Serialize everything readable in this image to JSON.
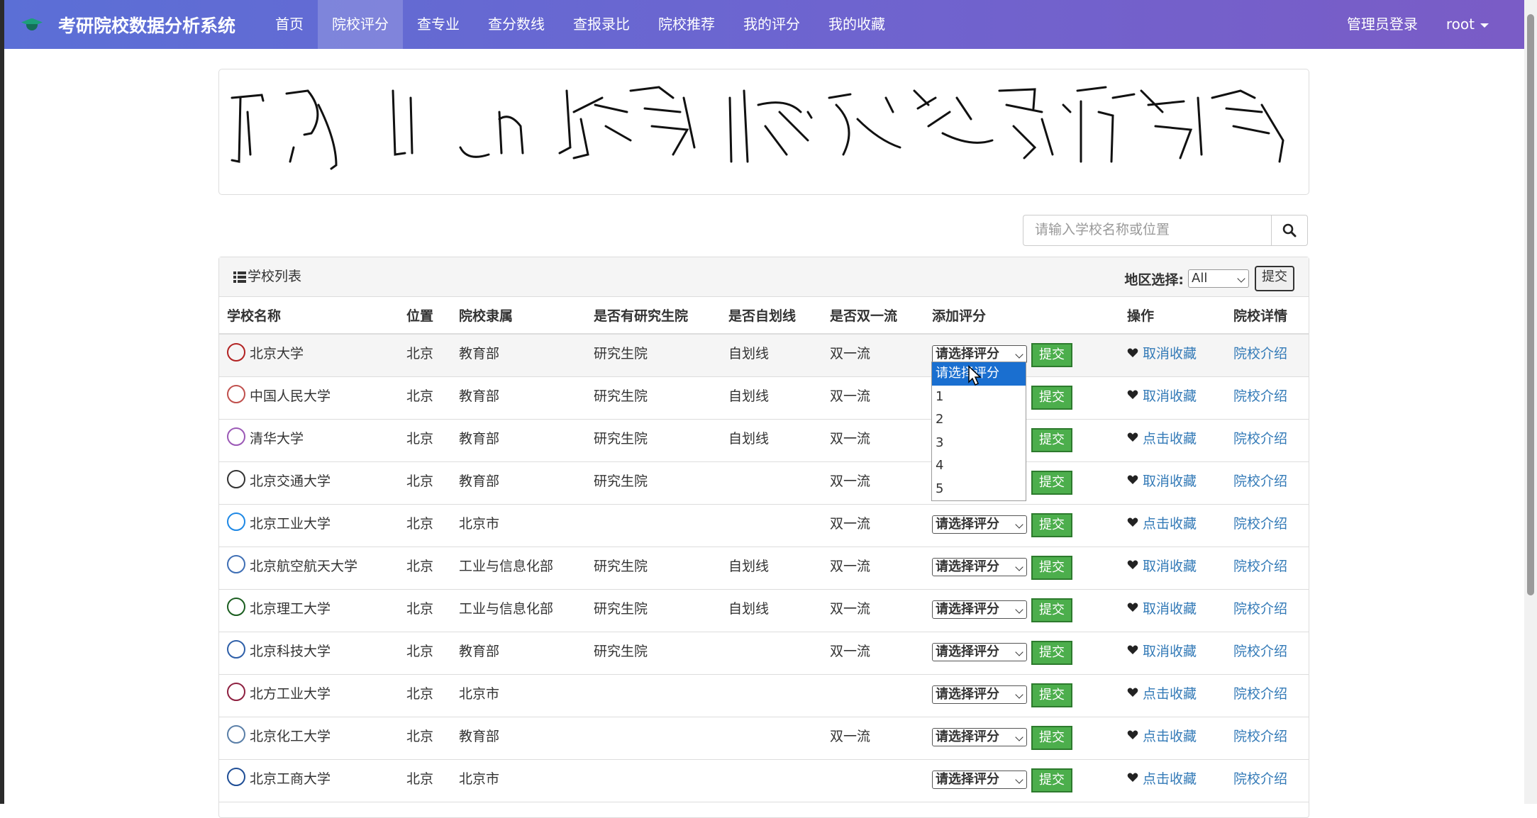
{
  "nav": {
    "brand": "考研院校数据分析系统",
    "items": [
      {
        "label": "首页",
        "active": false
      },
      {
        "label": "院校评分",
        "active": true
      },
      {
        "label": "查专业",
        "active": false
      },
      {
        "label": "查分数线",
        "active": false
      },
      {
        "label": "查报录比",
        "active": false
      },
      {
        "label": "院校推荐",
        "active": false
      },
      {
        "label": "我的评分",
        "active": false
      },
      {
        "label": "我的收藏",
        "active": false
      }
    ],
    "admin_login": "管理员登录",
    "user": "root"
  },
  "search": {
    "placeholder": "请输入学校名称或位置"
  },
  "panel": {
    "title": "学校列表",
    "region_label": "地区选择:",
    "region_value": "All",
    "region_submit": "提交"
  },
  "table": {
    "headers": [
      "学校名称",
      "位置",
      "院校隶属",
      "是否有研究生院",
      "是否自划线",
      "是否双一流",
      "添加评分",
      "操作",
      "院校详情"
    ],
    "rate_placeholder": "请选择评分",
    "submit_label": "提交",
    "detail_label": "院校介绍",
    "rows": [
      {
        "name": "北京大学",
        "location": "北京",
        "affiliation": "教育部",
        "grad_school": "研究生院",
        "self_line": "自划线",
        "double_first": "双一流",
        "fav": "取消收藏",
        "logo_color": "#b22222"
      },
      {
        "name": "中国人民大学",
        "location": "北京",
        "affiliation": "教育部",
        "grad_school": "研究生院",
        "self_line": "自划线",
        "double_first": "双一流",
        "fav": "取消收藏",
        "logo_color": "#c0504d"
      },
      {
        "name": "清华大学",
        "location": "北京",
        "affiliation": "教育部",
        "grad_school": "研究生院",
        "self_line": "自划线",
        "double_first": "双一流",
        "fav": "点击收藏",
        "logo_color": "#9b59b6"
      },
      {
        "name": "北京交通大学",
        "location": "北京",
        "affiliation": "教育部",
        "grad_school": "研究生院",
        "self_line": "",
        "double_first": "双一流",
        "fav": "取消收藏",
        "logo_color": "#333333"
      },
      {
        "name": "北京工业大学",
        "location": "北京",
        "affiliation": "北京市",
        "grad_school": "",
        "self_line": "",
        "double_first": "双一流",
        "fav": "点击收藏",
        "logo_color": "#1e88e5"
      },
      {
        "name": "北京航空航天大学",
        "location": "北京",
        "affiliation": "工业与信息化部",
        "grad_school": "研究生院",
        "self_line": "自划线",
        "double_first": "双一流",
        "fav": "取消收藏",
        "logo_color": "#3f6fb5"
      },
      {
        "name": "北京理工大学",
        "location": "北京",
        "affiliation": "工业与信息化部",
        "grad_school": "研究生院",
        "self_line": "自划线",
        "double_first": "双一流",
        "fav": "取消收藏",
        "logo_color": "#1b5e20"
      },
      {
        "name": "北京科技大学",
        "location": "北京",
        "affiliation": "教育部",
        "grad_school": "研究生院",
        "self_line": "",
        "double_first": "双一流",
        "fav": "取消收藏",
        "logo_color": "#2e5fa8"
      },
      {
        "name": "北方工业大学",
        "location": "北京",
        "affiliation": "北京市",
        "grad_school": "",
        "self_line": "",
        "double_first": "",
        "fav": "点击收藏",
        "logo_color": "#8e2040"
      },
      {
        "name": "北京化工大学",
        "location": "北京",
        "affiliation": "教育部",
        "grad_school": "",
        "self_line": "",
        "double_first": "双一流",
        "fav": "点击收藏",
        "logo_color": "#5a7fa8"
      },
      {
        "name": "北京工商大学",
        "location": "北京",
        "affiliation": "北京市",
        "grad_school": "",
        "self_line": "",
        "double_first": "",
        "fav": "点击收藏",
        "logo_color": "#1f4e96"
      }
    ]
  },
  "dropdown": {
    "options": [
      "请选择评分",
      "1",
      "2",
      "3",
      "4",
      "5"
    ],
    "selected_index": 0
  },
  "colors": {
    "nav_start": "#5b6fd6",
    "nav_end": "#7a5cc6",
    "link": "#337ab7",
    "submit": "#4cae4c",
    "dropdown_selected": "#1a6fd0"
  }
}
